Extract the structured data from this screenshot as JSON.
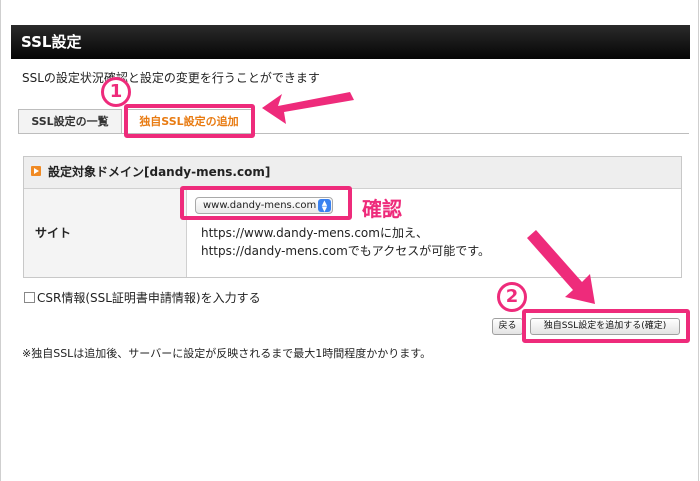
{
  "page": {
    "title": "SSL設定",
    "description": "SSLの設定状況確認と設定の変更を行うことができます"
  },
  "tabs": [
    {
      "label": "SSL設定の一覧",
      "active": false
    },
    {
      "label": "独自SSL設定の追加",
      "active": true
    }
  ],
  "panel": {
    "heading": "設定対象ドメイン[dandy-mens.com]",
    "site_label": "サイト",
    "site_select_value": "www.dandy-mens.com",
    "info_line1": "https://www.dandy-mens.comに加え、",
    "info_line2": "https://dandy-mens.comでもアクセスが可能です。"
  },
  "csr": {
    "label": "CSR情報(SSL証明書申請情報)を入力する",
    "checked": false
  },
  "buttons": {
    "back": "戻る",
    "add": "独自SSL設定を追加する(確定)"
  },
  "note": "※独自SSLは追加後、サーバーに設定が反映されるまで最大1時間程度かかります。",
  "annotations": {
    "step1": "1",
    "step2": "2",
    "confirm": "確認",
    "color": "#ee2b7b"
  },
  "colors": {
    "accent_tab_text": "#e87b12",
    "heading_icon": "#f08a24",
    "titlebar": "#111111"
  }
}
